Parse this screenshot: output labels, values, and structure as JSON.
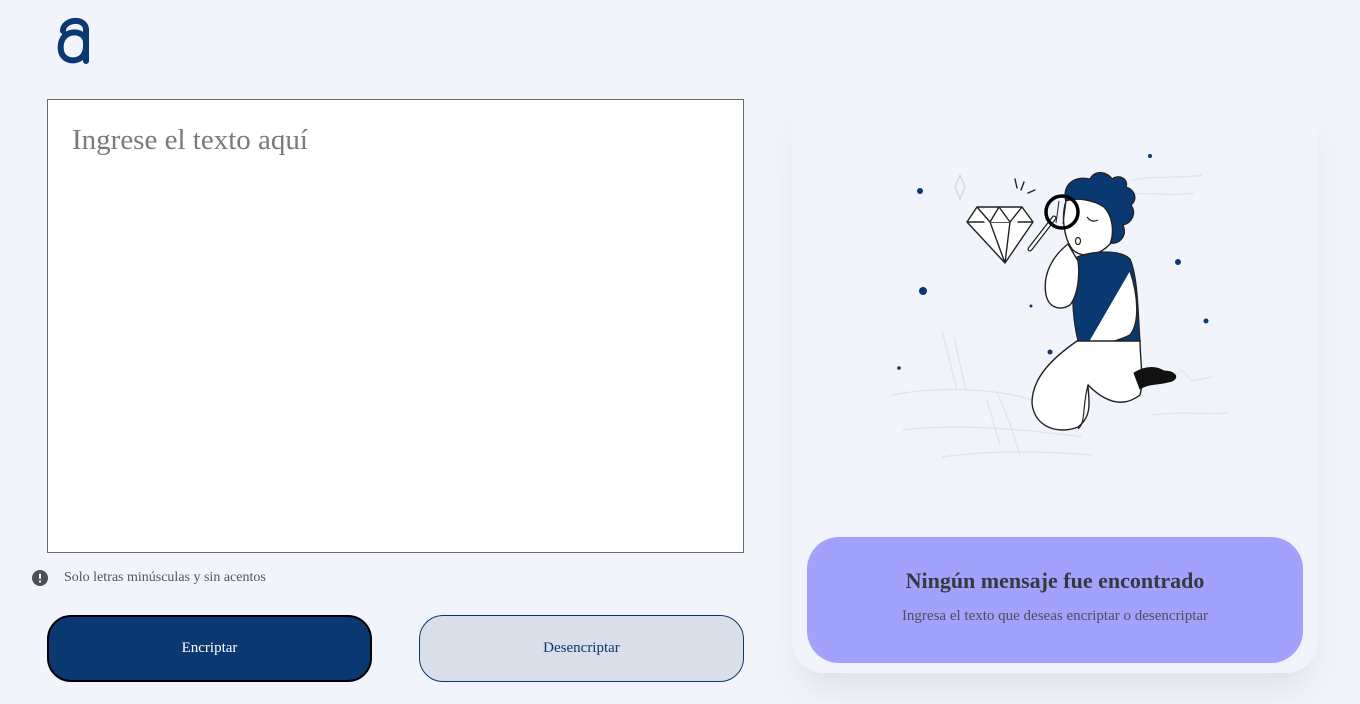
{
  "logo": {
    "icon": "alura-logo"
  },
  "input": {
    "placeholder": "Ingrese el texto aquí",
    "value": ""
  },
  "hint": {
    "icon": "exclamation-circle-icon",
    "text": "Solo letras minúsculas y sin acentos"
  },
  "buttons": {
    "encrypt": "Encriptar",
    "decrypt": "Desencriptar"
  },
  "output": {
    "illustration": "person-with-magnifying-glass-looking-at-diamond",
    "title": "Ningún mensaje fue encontrado",
    "subtitle": "Ingresa el texto que deseas encriptar o desencriptar"
  },
  "colors": {
    "background": "#f1f4fb",
    "primary": "#0a3871",
    "secondary_button": "#d8dfe8",
    "message_box": "#a2a2fd"
  }
}
